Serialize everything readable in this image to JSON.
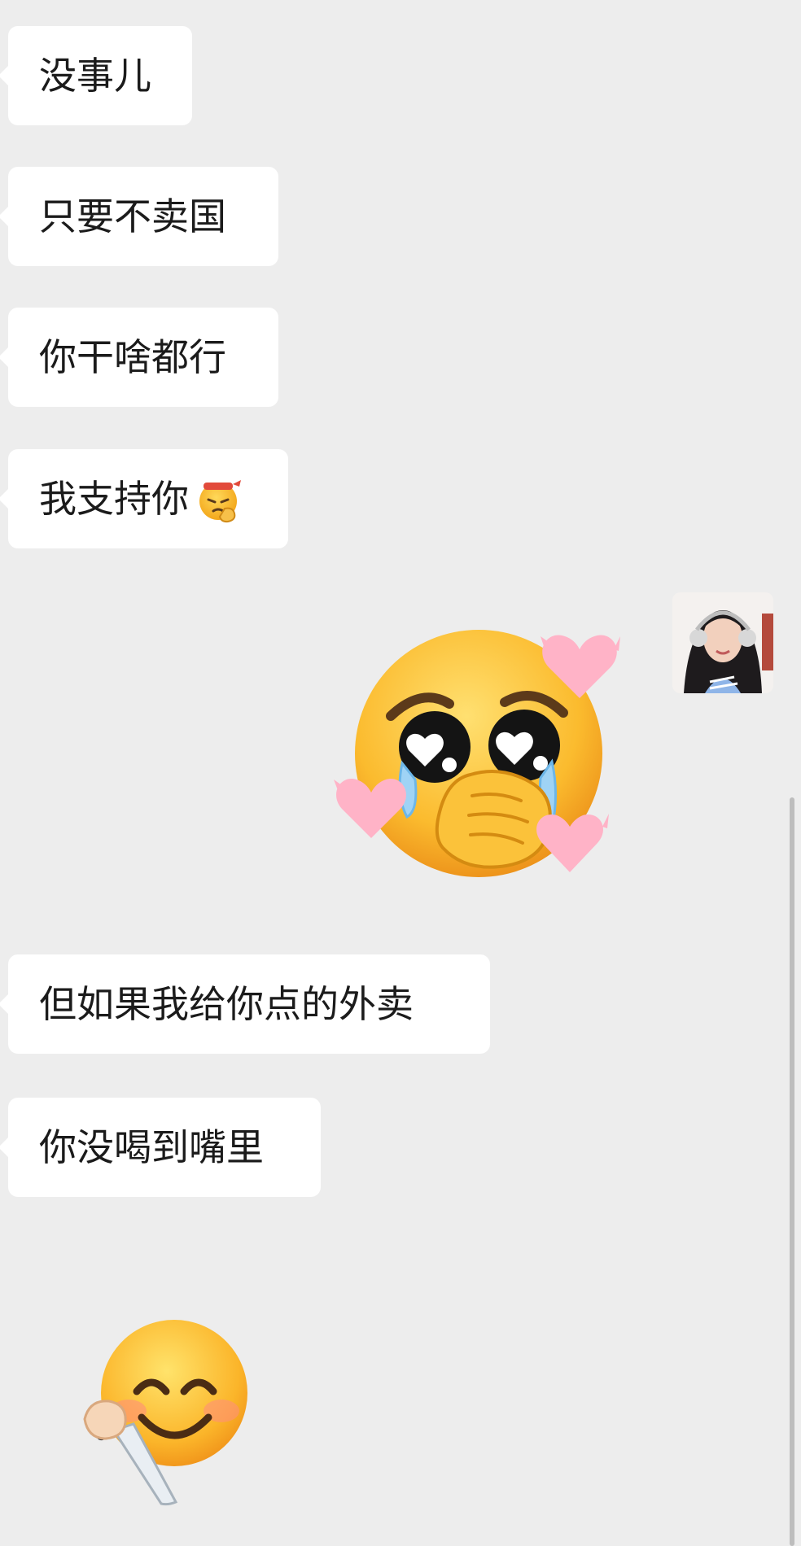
{
  "messages": [
    {
      "text": "没事儿"
    },
    {
      "text": "只要不卖国"
    },
    {
      "text": "你干啥都行"
    },
    {
      "text": "我支持你",
      "emoji": "determined-thumb-emoji"
    },
    {
      "text": "但如果我给你点的外卖"
    },
    {
      "text": "你没喝到嘴里"
    }
  ],
  "stickers": {
    "pleading": "pleading-face-with-hearts-icon",
    "smile": "smiling-face-with-knife-icon"
  },
  "avatar": "user-avatar"
}
